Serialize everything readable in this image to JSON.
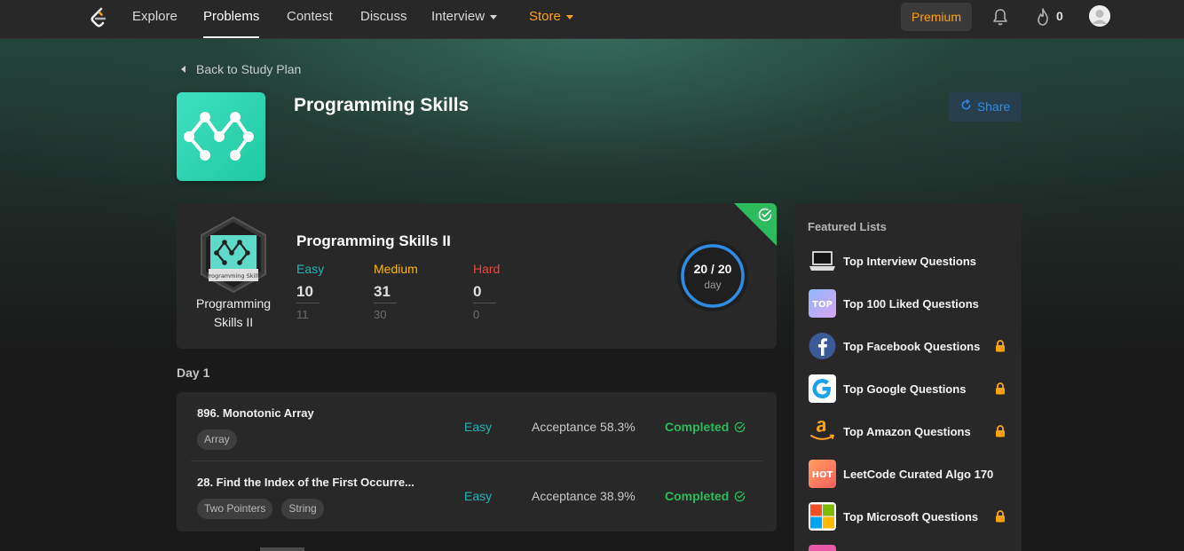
{
  "nav": {
    "items": [
      "Explore",
      "Problems",
      "Contest",
      "Discuss",
      "Interview",
      "Store"
    ],
    "active": "Problems",
    "premium_label": "Premium",
    "streak_count": "0",
    "accent": "#ffa116"
  },
  "header": {
    "back_label": "Back to Study Plan",
    "title": "Programming Skills",
    "share_label": "Share"
  },
  "progress": {
    "title": "Programming Skills II",
    "badge_label": "Programming Skills II",
    "badge_text": "Programming Skills",
    "easy": {
      "label": "Easy",
      "done": "10",
      "total": "11"
    },
    "medium": {
      "label": "Medium",
      "done": "31",
      "total": "30"
    },
    "hard": {
      "label": "Hard",
      "done": "0",
      "total": "0"
    },
    "days_text": "20 / 20",
    "days_unit": "day",
    "days_fraction": 1.0
  },
  "day": {
    "label": "Day 1",
    "questions": [
      {
        "title": "896. Monotonic Array",
        "tags": [
          "Array"
        ],
        "difficulty": "Easy",
        "acceptance": "Acceptance 58.3%",
        "status": "Completed"
      },
      {
        "title": "28. Find the Index of the First Occurre...",
        "tags": [
          "Two Pointers",
          "String"
        ],
        "difficulty": "Easy",
        "acceptance": "Acceptance 38.9%",
        "status": "Completed"
      }
    ]
  },
  "featured": {
    "title": "Featured Lists",
    "items": [
      {
        "label": "Top Interview Questions",
        "icon": "laptop-icon",
        "locked": false
      },
      {
        "label": "Top 100 Liked Questions",
        "icon": "top-icon",
        "locked": false
      },
      {
        "label": "Top Facebook Questions",
        "icon": "facebook-icon",
        "locked": true
      },
      {
        "label": "Top Google Questions",
        "icon": "google-icon",
        "locked": true
      },
      {
        "label": "Top Amazon Questions",
        "icon": "amazon-icon",
        "locked": true
      },
      {
        "label": "LeetCode Curated Algo 170",
        "icon": "hot-icon",
        "locked": false
      },
      {
        "label": "Top Microsoft Questions",
        "icon": "microsoft-icon",
        "locked": true
      }
    ],
    "top_icon_text": "TOP",
    "hot_icon_text": "HOT"
  }
}
